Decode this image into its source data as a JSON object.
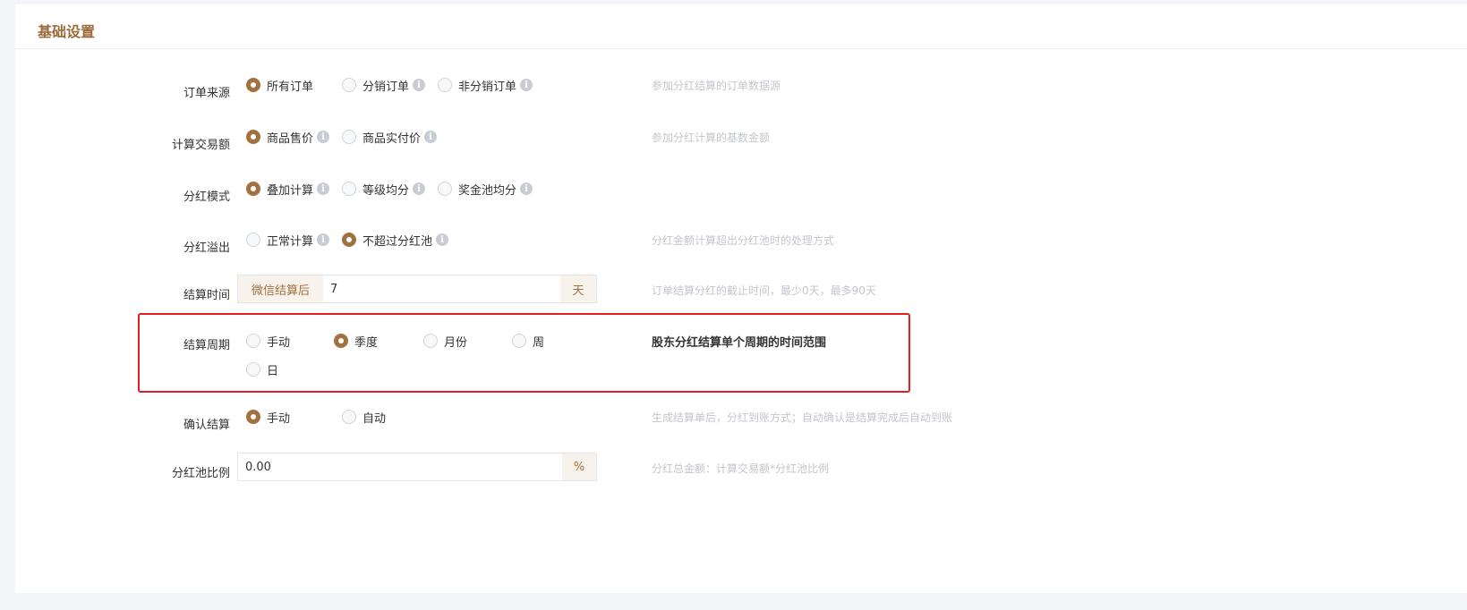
{
  "header": {
    "title": "基础设置"
  },
  "order_source": {
    "label": "订单来源",
    "options": [
      "所有订单",
      "分销订单",
      "非分销订单"
    ],
    "hint": "参加分红结算的订单数据源"
  },
  "trade_amount": {
    "label": "计算交易额",
    "options": [
      "商品售价",
      "商品实付价"
    ],
    "hint": "参加分红计算的基数金额"
  },
  "dividend_mode": {
    "label": "分红模式",
    "options": [
      "叠加计算",
      "等级均分",
      "奖金池均分"
    ]
  },
  "overflow": {
    "label": "分红溢出",
    "options": [
      "正常计算",
      "不超过分红池"
    ],
    "hint": "分红金额计算超出分红池时的处理方式"
  },
  "settle_time": {
    "label": "结算时间",
    "prefix": "微信结算后",
    "value": "7",
    "suffix": "天",
    "hint": "订单结算分红的截止时间，最少0天，最多90天"
  },
  "settle_period": {
    "label": "结算周期",
    "options": [
      "手动",
      "季度",
      "月份",
      "周",
      "日"
    ],
    "hint": "股东分红结算单个周期的时间范围"
  },
  "confirm": {
    "label": "确认结算",
    "options": [
      "手动",
      "自动"
    ],
    "hint": "生成结算单后，分红到账方式；自动确认是结算完成后自动到账"
  },
  "pool_ratio": {
    "label": "分红池比例",
    "value": "0.00",
    "suffix": "%",
    "hint": "分红总金额：计算交易额*分红池比例"
  },
  "colors": {
    "accent": "#a2713f",
    "title": "#9b6a3a",
    "highlight": "#e02020"
  }
}
